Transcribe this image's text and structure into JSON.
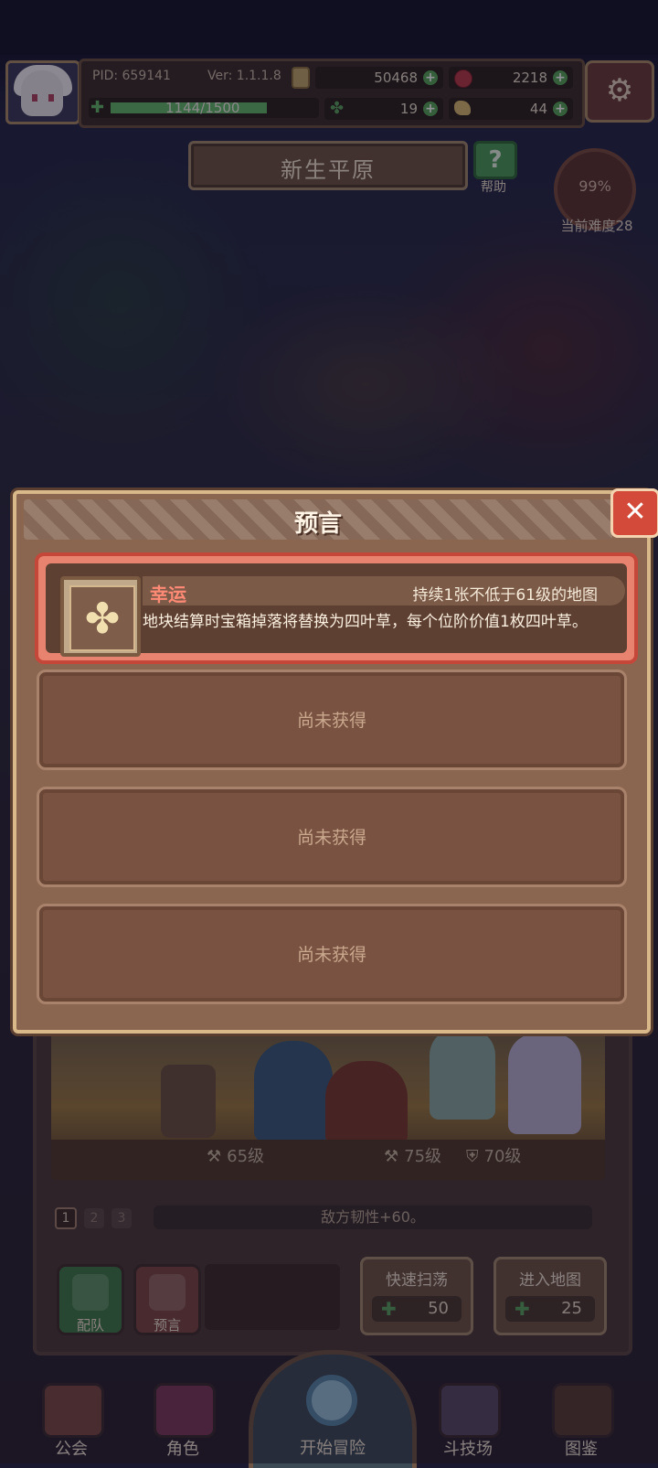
{
  "header": {
    "pid": "PID: 659141",
    "version": "Ver: 1.1.1.8",
    "gold": "50468",
    "gems": "2218",
    "stamina": {
      "text": "1144/1500",
      "fraction": 0.763
    },
    "clovers": "19",
    "food": "44",
    "settings_icon": "gear-icon"
  },
  "map": {
    "title": "新生平原",
    "help_label": "帮助",
    "progress": "99%",
    "difficulty": "当前难度28"
  },
  "stage": {
    "levels": [
      "65级",
      "75级",
      "70级"
    ],
    "tabs": [
      "1",
      "2",
      "3"
    ],
    "enemy_info": "敌方韧性+60。",
    "team_label": "配队",
    "prophecy_label": "预言",
    "sweep": {
      "label": "快速扫荡",
      "cost": "50"
    },
    "enter": {
      "label": "进入地图",
      "cost": "25"
    }
  },
  "nav": {
    "guild": "公会",
    "roles": "角色",
    "start": "开始冒险",
    "arena": "斗技场",
    "codex": "图鉴"
  },
  "modal": {
    "title": "预言",
    "close_icon": "close-icon",
    "card": {
      "name": "幸运",
      "duration": "持续1张不低于61级的地图",
      "description": "地块结算时宝箱掉落将替换为四叶草，每个位阶价值1枚四叶草。",
      "icon": "four-leaf-clover-icon"
    },
    "empty_slots": [
      "尚未获得",
      "尚未获得",
      "尚未获得"
    ]
  },
  "colors": {
    "accent_red": "#d44a3a",
    "card_border": "#c5473a",
    "green": "#57a658"
  }
}
